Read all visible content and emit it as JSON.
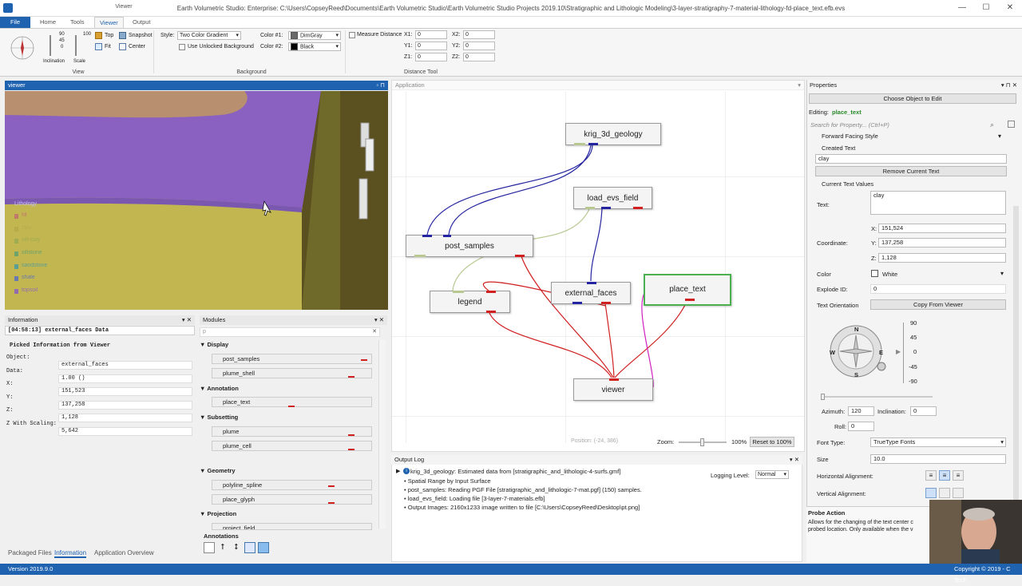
{
  "window": {
    "title": "Earth Volumetric Studio: Enterprise: C:\\Users\\CopseyReed\\Documents\\Earth Volumetric Studio\\Earth Volumetric Studio Projects 2019.10\\Stratigraphic and Lithologic Modeling\\3-layer-stratigraphy-7-material-lithology-fd-place_text.efb.evs",
    "context_tab": "Viewer",
    "min": "—",
    "max": "☐",
    "close": "✕"
  },
  "ribbon": {
    "tabs": [
      "File",
      "Home",
      "Tools",
      "Viewer",
      "Output"
    ],
    "view_buttons": {
      "top": "Top",
      "fit": "Fit",
      "snapshot": "Snapshot",
      "center": "Center"
    },
    "mini_scale": {
      "inclination": "Inclination",
      "scale": "Scale",
      "t90": "90",
      "t45": "45",
      "t0": "0",
      "t100": "100"
    },
    "style_label": "Style:",
    "style_value": "Two Color Gradient",
    "use_unlocked": "Use Unlocked Background",
    "color1_label": "Color #1:",
    "color1_value": "DimGray",
    "color1_hex": "#696969",
    "color2_label": "Color #2:",
    "color2_value": "Black",
    "color2_hex": "#000000",
    "measure_label": "Measure Distance",
    "x1": "X1:",
    "x1v": "0",
    "y1": "Y1:",
    "y1v": "0",
    "z1": "Z1:",
    "z1v": "0",
    "x2": "X2:",
    "x2v": "0",
    "y2": "Y2:",
    "y2v": "0",
    "z2": "Z2:",
    "z2v": "0",
    "groups": {
      "view": "View",
      "background": "Background",
      "distance": "Distance Tool"
    }
  },
  "viewer": {
    "title": "viewer",
    "legend_title": "Lithology",
    "legend": [
      {
        "label": "fill",
        "color": "#c07070"
      },
      {
        "label": "clay",
        "color": "#b8a848"
      },
      {
        "label": "silt-clay",
        "color": "#9aaa50"
      },
      {
        "label": "siltstone",
        "color": "#60a070"
      },
      {
        "label": "sandstone",
        "color": "#4a9aa0"
      },
      {
        "label": "shale",
        "color": "#5a70c0"
      },
      {
        "label": "topsoil",
        "color": "#8a60c0"
      }
    ]
  },
  "application": {
    "title": "Application",
    "position": "Position: (-24, 386)",
    "zoom_label": "Zoom:",
    "zoom_value": "100%",
    "reset_btn": "Reset to 100%",
    "nodes": {
      "krig": "krig_3d_geology",
      "load": "load_evs_field",
      "post": "post_samples",
      "legend": "legend",
      "ext": "external_faces",
      "place": "place_text",
      "viewer": "viewer"
    }
  },
  "information": {
    "title": "Information",
    "header": "[04:58:13] external_faces Data",
    "picked": "Picked Information from Viewer",
    "rows": [
      {
        "k": "Object:",
        "v": "external_faces"
      },
      {
        "k": "Data:",
        "v": "1.00 ()"
      },
      {
        "k": "X:",
        "v": "151,523"
      },
      {
        "k": "Y:",
        "v": "137,258"
      },
      {
        "k": "Z:",
        "v": "1,128"
      },
      {
        "k": "Z With Scaling:",
        "v": "5,642"
      }
    ]
  },
  "modules": {
    "title": "Modules",
    "search": "p",
    "clear": "✕",
    "cats": {
      "display": "Display",
      "annotation": "Annotation",
      "subsetting": "Subsetting",
      "geometry": "Geometry",
      "projection": "Projection"
    },
    "items": {
      "post_samples": "post_samples",
      "plume_shell": "plume_shell",
      "place_text": "place_text",
      "plume": "plume",
      "plume_cell": "plume_cell",
      "polyline_spline": "polyline_spline",
      "place_glyph": "place_glyph",
      "project_field": "project_field"
    },
    "annotations": "Annotations"
  },
  "output_log": {
    "title": "Output Log",
    "logging_label": "Logging Level:",
    "logging_value": "Normal",
    "lines": [
      "krig_3d_geology: Estimated data from [stratigraphic_and_lithologic-4-surfs.gmf]",
      "Spatial Range by Input Surface",
      "post_samples: Reading PGF File [stratigraphic_and_lithologic-7-mat.pgf] (150) samples.",
      "load_evs_field: Loading file [3-layer-7-materials.efb]",
      "Output Images: 2160x1233 image written to file [C:\\Users\\CopseyReed\\Desktop\\pt.png]"
    ]
  },
  "properties": {
    "title": "Properties",
    "choose_btn": "Choose Object to Edit",
    "editing_label": "Editing:",
    "editing_value": "place_text",
    "search": "Search for Property... (Ctrl+P)",
    "forward_style": "Forward Facing Style",
    "created_text": "Created Text",
    "created_value": "clay",
    "remove_btn": "Remove Current Text",
    "current_values": "Current Text Values",
    "text_label": "Text:",
    "text_value": "clay",
    "coord_label": "Coordinate:",
    "x_label": "X:",
    "x_value": "151,524",
    "y_label": "Y:",
    "y_value": "137,258",
    "z_label": "Z:",
    "z_value": "1,128",
    "color_label": "Color",
    "color_value": "White",
    "explode_label": "Explode ID:",
    "explode_value": "0",
    "orient_label": "Text Orientation",
    "copy_btn": "Copy From Viewer",
    "compass": {
      "n": "N",
      "s": "S",
      "e": "E",
      "w": "W"
    },
    "scale": [
      "90",
      "45",
      "0",
      "-45",
      "-90"
    ],
    "azimuth_label": "Azimuth:",
    "azimuth_value": "120",
    "incl_label": "Inclination:",
    "incl_value": "0",
    "roll_label": "Roll:",
    "roll_value": "0",
    "font_type_label": "Font Type:",
    "font_type_value": "TrueType Fonts",
    "size_label": "Size",
    "size_value": "10.0",
    "halign_label": "Horizontal Alignment:",
    "valign_label": "Vertical Alignment:",
    "probe_title": "Probe Action",
    "probe_desc": "Allows for the changing of the text center c probed location. Only available when the v"
  },
  "bottom_tabs": {
    "packaged": "Packaged Files",
    "information": "Information",
    "overview": "Application Overview"
  },
  "status": {
    "version": "Version 2019.9.0",
    "copyright": "Copyright © 2019 - C Tech"
  }
}
